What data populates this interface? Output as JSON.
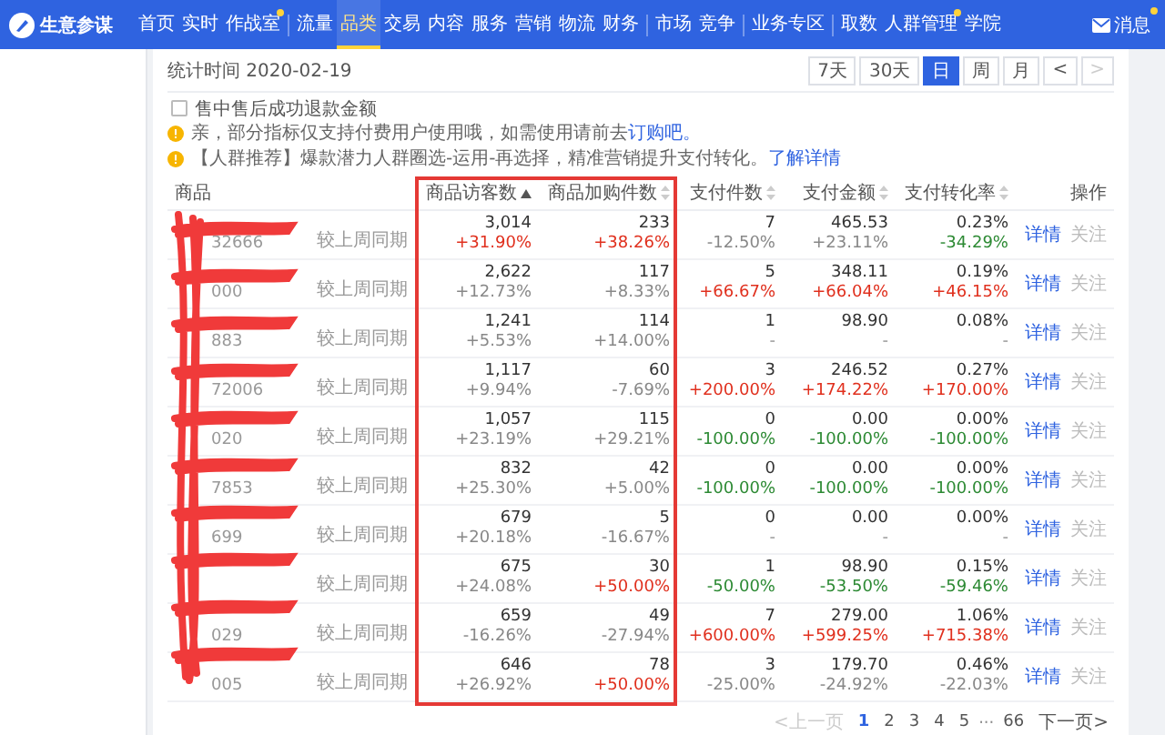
{
  "nav": {
    "brand": "生意参谋",
    "groups": [
      [
        {
          "label": "首页",
          "selected": false,
          "dot": false
        },
        {
          "label": "实时",
          "selected": false,
          "dot": false
        },
        {
          "label": "作战室",
          "selected": false,
          "dot": true
        }
      ],
      [
        {
          "label": "流量",
          "selected": false,
          "dot": false
        },
        {
          "label": "品类",
          "selected": true,
          "dot": false
        },
        {
          "label": "交易",
          "selected": false,
          "dot": false
        },
        {
          "label": "内容",
          "selected": false,
          "dot": false
        },
        {
          "label": "服务",
          "selected": false,
          "dot": false
        },
        {
          "label": "营销",
          "selected": false,
          "dot": false
        },
        {
          "label": "物流",
          "selected": false,
          "dot": false
        },
        {
          "label": "财务",
          "selected": false,
          "dot": false
        }
      ],
      [
        {
          "label": "市场",
          "selected": false,
          "dot": false
        },
        {
          "label": "竞争",
          "selected": false,
          "dot": false
        }
      ],
      [
        {
          "label": "业务专区",
          "selected": false,
          "dot": false
        }
      ],
      [
        {
          "label": "取数",
          "selected": false,
          "dot": false
        },
        {
          "label": "人群管理",
          "selected": false,
          "dot": true
        },
        {
          "label": "学院",
          "selected": false,
          "dot": false
        }
      ]
    ],
    "message": {
      "label": "消息",
      "dot": true
    }
  },
  "stat_date": "统计时间 2020-02-19",
  "ranges": [
    {
      "label": "7天",
      "selected": false,
      "disabled": false
    },
    {
      "label": "30天",
      "selected": false,
      "disabled": false
    },
    {
      "label": "日",
      "selected": true,
      "disabled": false
    },
    {
      "label": "周",
      "selected": false,
      "disabled": false
    },
    {
      "label": "月",
      "selected": false,
      "disabled": false
    },
    {
      "label": "<",
      "selected": false,
      "disabled": false
    },
    {
      "label": ">",
      "selected": false,
      "disabled": true
    }
  ],
  "option": {
    "label": "售中售后成功退款金额",
    "checked": false
  },
  "notices": [
    {
      "text": "亲，部分指标仅支持付费用户使用哦，如需使用请前去",
      "link": "订购吧。"
    },
    {
      "text": "【人群推荐】爆款潜力人群圈选-运用-再选择，精准营销提升支付转化。",
      "link": "了解详情"
    }
  ],
  "table": {
    "columns": [
      {
        "label": "商品"
      },
      {
        "label": "商品访客数",
        "sorted": true
      },
      {
        "label": "商品加购件数",
        "sorted": false
      },
      {
        "label": "支付件数",
        "sorted": false
      },
      {
        "label": "支付金额",
        "sorted": false
      },
      {
        "label": "支付转化率",
        "sorted": false
      },
      {
        "label": "操作"
      }
    ],
    "rows": [
      {
        "cells": [
          {
            "kind": "product",
            "code": "32666",
            "compare": "较上周同期"
          },
          {
            "kind": "metric",
            "value": "3,014",
            "change": "+31.90%",
            "color": "#e0301e"
          },
          {
            "kind": "metric",
            "value": "233",
            "change": "+38.26%",
            "color": "#e0301e"
          },
          {
            "kind": "metric",
            "value": "7",
            "change": "-12.50%",
            "color": "#888888"
          },
          {
            "kind": "metric",
            "value": "465.53",
            "change": "+23.11%",
            "color": "#888888"
          },
          {
            "kind": "metric",
            "value": "0.23%",
            "change": "-34.29%",
            "color": "#2d8a34"
          },
          {
            "kind": "actions",
            "links": [
              "详情",
              "关注"
            ]
          }
        ]
      },
      {
        "cells": [
          {
            "kind": "product",
            "code": "000",
            "compare": "较上周同期"
          },
          {
            "kind": "metric",
            "value": "2,622",
            "change": "+12.73%",
            "color": "#888888"
          },
          {
            "kind": "metric",
            "value": "117",
            "change": "+8.33%",
            "color": "#888888"
          },
          {
            "kind": "metric",
            "value": "5",
            "change": "+66.67%",
            "color": "#e0301e"
          },
          {
            "kind": "metric",
            "value": "348.11",
            "change": "+66.04%",
            "color": "#e0301e"
          },
          {
            "kind": "metric",
            "value": "0.19%",
            "change": "+46.15%",
            "color": "#e0301e"
          },
          {
            "kind": "actions",
            "links": [
              "详情",
              "关注"
            ]
          }
        ]
      },
      {
        "cells": [
          {
            "kind": "product",
            "code": "883",
            "compare": "较上周同期"
          },
          {
            "kind": "metric",
            "value": "1,241",
            "change": "+5.53%",
            "color": "#888888"
          },
          {
            "kind": "metric",
            "value": "114",
            "change": "+14.00%",
            "color": "#888888"
          },
          {
            "kind": "metric",
            "value": "1",
            "change": "-"
          },
          {
            "kind": "metric",
            "value": "98.90",
            "change": "-"
          },
          {
            "kind": "metric",
            "value": "0.08%",
            "change": "-"
          },
          {
            "kind": "actions",
            "links": [
              "详情",
              "关注"
            ]
          }
        ]
      },
      {
        "cells": [
          {
            "kind": "product",
            "code": "72006",
            "compare": "较上周同期"
          },
          {
            "kind": "metric",
            "value": "1,117",
            "change": "+9.94%",
            "color": "#888888"
          },
          {
            "kind": "metric",
            "value": "60",
            "change": "-7.69%",
            "color": "#888888"
          },
          {
            "kind": "metric",
            "value": "3",
            "change": "+200.00%",
            "color": "#e0301e"
          },
          {
            "kind": "metric",
            "value": "246.52",
            "change": "+174.22%",
            "color": "#e0301e"
          },
          {
            "kind": "metric",
            "value": "0.27%",
            "change": "+170.00%",
            "color": "#e0301e"
          },
          {
            "kind": "actions",
            "links": [
              "详情",
              "关注"
            ]
          }
        ]
      },
      {
        "cells": [
          {
            "kind": "product",
            "code": "020",
            "compare": "较上周同期"
          },
          {
            "kind": "metric",
            "value": "1,057",
            "change": "+23.19%",
            "color": "#888888"
          },
          {
            "kind": "metric",
            "value": "115",
            "change": "+29.21%",
            "color": "#888888"
          },
          {
            "kind": "metric",
            "value": "0",
            "change": "-100.00%",
            "color": "#2d8a34"
          },
          {
            "kind": "metric",
            "value": "0.00",
            "change": "-100.00%",
            "color": "#2d8a34"
          },
          {
            "kind": "metric",
            "value": "0.00%",
            "change": "-100.00%",
            "color": "#2d8a34"
          },
          {
            "kind": "actions",
            "links": [
              "详情",
              "关注"
            ]
          }
        ]
      },
      {
        "cells": [
          {
            "kind": "product",
            "code": "7853",
            "compare": "较上周同期"
          },
          {
            "kind": "metric",
            "value": "832",
            "change": "+25.30%",
            "color": "#888888"
          },
          {
            "kind": "metric",
            "value": "42",
            "change": "+5.00%",
            "color": "#888888"
          },
          {
            "kind": "metric",
            "value": "0",
            "change": "-100.00%",
            "color": "#2d8a34"
          },
          {
            "kind": "metric",
            "value": "0.00",
            "change": "-100.00%",
            "color": "#2d8a34"
          },
          {
            "kind": "metric",
            "value": "0.00%",
            "change": "-100.00%",
            "color": "#2d8a34"
          },
          {
            "kind": "actions",
            "links": [
              "详情",
              "关注"
            ]
          }
        ]
      },
      {
        "cells": [
          {
            "kind": "product",
            "code": "699",
            "compare": "较上周同期"
          },
          {
            "kind": "metric",
            "value": "679",
            "change": "+20.18%",
            "color": "#888888"
          },
          {
            "kind": "metric",
            "value": "5",
            "change": "-16.67%",
            "color": "#888888"
          },
          {
            "kind": "metric",
            "value": "0",
            "change": "-"
          },
          {
            "kind": "metric",
            "value": "0.00",
            "change": "-"
          },
          {
            "kind": "metric",
            "value": "0.00%",
            "change": "-"
          },
          {
            "kind": "actions",
            "links": [
              "详情",
              "关注"
            ]
          }
        ]
      },
      {
        "cells": [
          {
            "kind": "product",
            "compare": "较上周同期"
          },
          {
            "kind": "metric",
            "value": "675",
            "change": "+24.08%",
            "color": "#888888"
          },
          {
            "kind": "metric",
            "value": "30",
            "change": "+50.00%",
            "color": "#e0301e"
          },
          {
            "kind": "metric",
            "value": "1",
            "change": "-50.00%",
            "color": "#2d8a34"
          },
          {
            "kind": "metric",
            "value": "98.90",
            "change": "-53.50%",
            "color": "#2d8a34"
          },
          {
            "kind": "metric",
            "value": "0.15%",
            "change": "-59.46%",
            "color": "#2d8a34"
          },
          {
            "kind": "actions",
            "links": [
              "详情",
              "关注"
            ]
          }
        ]
      },
      {
        "cells": [
          {
            "kind": "product",
            "code": "029",
            "compare": "较上周同期"
          },
          {
            "kind": "metric",
            "value": "659",
            "change": "-16.26%",
            "color": "#888888"
          },
          {
            "kind": "metric",
            "value": "49",
            "change": "-27.94%",
            "color": "#888888"
          },
          {
            "kind": "metric",
            "value": "7",
            "change": "+600.00%",
            "color": "#e0301e"
          },
          {
            "kind": "metric",
            "value": "279.00",
            "change": "+599.25%",
            "color": "#e0301e"
          },
          {
            "kind": "metric",
            "value": "1.06%",
            "change": "+715.38%",
            "color": "#e0301e"
          },
          {
            "kind": "actions",
            "links": [
              "详情",
              "关注"
            ]
          }
        ]
      },
      {
        "cells": [
          {
            "kind": "product",
            "code": "005",
            "compare": "较上周同期"
          },
          {
            "kind": "metric",
            "value": "646",
            "change": "+26.92%",
            "color": "#888888"
          },
          {
            "kind": "metric",
            "value": "78",
            "change": "+50.00%",
            "color": "#e0301e"
          },
          {
            "kind": "metric",
            "value": "3",
            "change": "-25.00%",
            "color": "#888888"
          },
          {
            "kind": "metric",
            "value": "179.70",
            "change": "-24.92%",
            "color": "#888888"
          },
          {
            "kind": "metric",
            "value": "0.46%",
            "change": "-22.03%",
            "color": "#888888"
          },
          {
            "kind": "actions",
            "links": [
              "详情",
              "关注"
            ]
          }
        ]
      }
    ]
  },
  "pagination": [
    {
      "kind": "prev",
      "label": "<上一页",
      "disabled": true
    },
    {
      "kind": "page",
      "label": "1",
      "selected": true
    },
    {
      "kind": "page",
      "label": "2",
      "selected": false
    },
    {
      "kind": "page",
      "label": "3",
      "selected": false
    },
    {
      "kind": "page",
      "label": "4",
      "selected": false
    },
    {
      "kind": "page",
      "label": "5",
      "selected": false
    },
    {
      "kind": "ellipsis",
      "label": "···"
    },
    {
      "kind": "page",
      "label": "66",
      "selected": false
    },
    {
      "kind": "next",
      "label": "下一页>",
      "disabled": false
    }
  ]
}
